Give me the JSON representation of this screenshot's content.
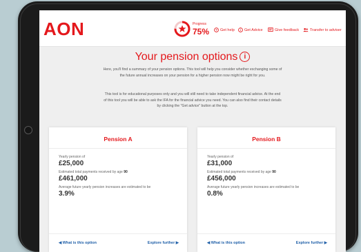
{
  "header": {
    "logo": "AON",
    "progress_label": "Progress",
    "progress_value": "75%",
    "progress_fraction": 0.75,
    "nav": [
      {
        "label": "Get help",
        "icon": "help-icon"
      },
      {
        "label": "Get Advice",
        "icon": "info-icon"
      },
      {
        "label": "Give feedback",
        "icon": "feedback-icon"
      },
      {
        "label": "Transfer to adviser",
        "icon": "users-icon"
      }
    ]
  },
  "main": {
    "title": "Your pension options",
    "info_glyph": "i",
    "para1": "Here, you'll find a summary of your pension options. This tool will help you consider whether exchanging some of the future annual increases on your pension for a higher pension now might be right for you.",
    "para2": "This tool is for educational purposes only and you will still need to take independent financial advice. At the end of this tool you will be able to ask the IFA for the financial advice you need. You can also find their contact details by clicking the \"Get advice\" button at the top."
  },
  "cards": [
    {
      "title": "Pension A",
      "yearly_label": "Yearly pension of",
      "yearly_value": "£25,000",
      "total_label": "Estimated total payments received by age",
      "total_age": "90",
      "total_value": "£461,000",
      "increase_label": "Average future yearly pension increases are estimated to be",
      "increase_value": "3.9%",
      "what_link": "What is this option",
      "explore_link": "Explore further"
    },
    {
      "title": "Pension B",
      "yearly_label": "Yearly pension of",
      "yearly_value": "£31,000",
      "total_label": "Estimated total payments received by age",
      "total_age": "90",
      "total_value": "£456,000",
      "increase_label": "Average future yearly pension increases are estimated to be",
      "increase_value": "0.8%",
      "what_link": "What is this option",
      "explore_link": "Explore further"
    }
  ],
  "colors": {
    "brand_red": "#e4181c",
    "link_blue": "#1f5fa8",
    "background": "#b9cdd2"
  }
}
